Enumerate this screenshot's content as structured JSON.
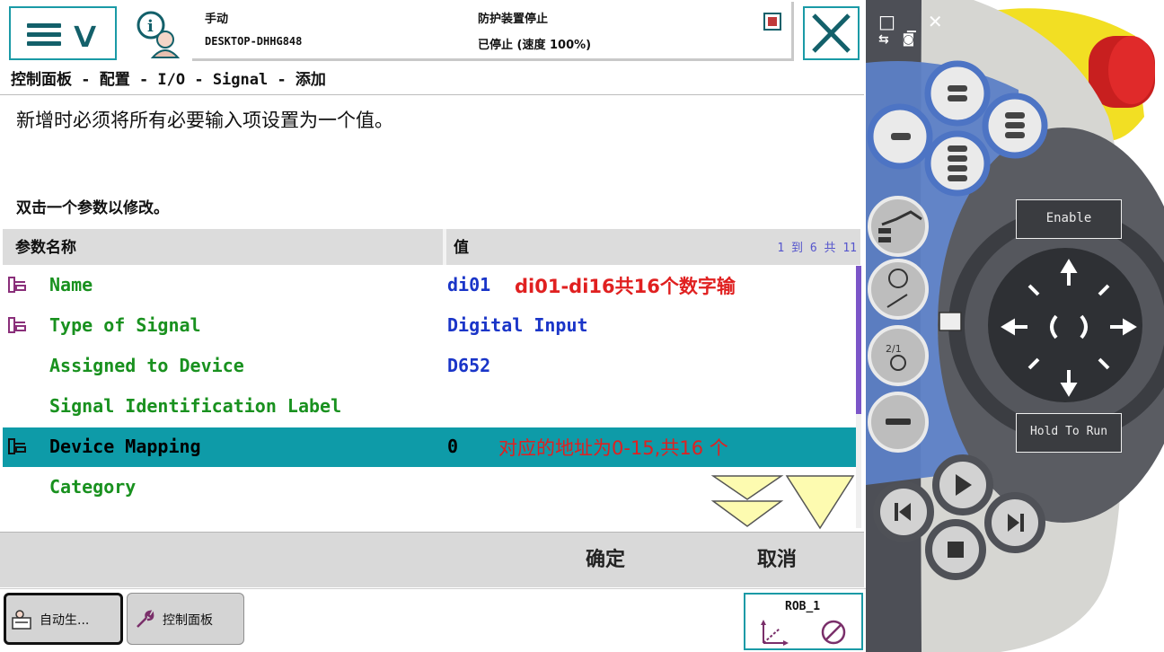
{
  "status": {
    "mode": "手动",
    "controller": "DESKTOP-DHHG848",
    "state": "防护装置停止",
    "speed_text": "已停止 (速度 100%)"
  },
  "breadcrumb": "控制面板 - 配置 - I/O - Signal - 添加",
  "info": {
    "line1": "新增时必须将所有必要输入项设置为一个值。",
    "line2": "双击一个参数以修改。"
  },
  "table": {
    "col_name": "参数名称",
    "col_value": "值",
    "counter": "1 到 6 共 11",
    "rows": [
      {
        "name": "Name",
        "value": "di01",
        "note": "di01-di16共16个数字输"
      },
      {
        "name": "Type of Signal",
        "value": "Digital Input",
        "note": ""
      },
      {
        "name": "Assigned to Device",
        "value": "D652",
        "note": ""
      },
      {
        "name": "Signal Identification Label",
        "value": "",
        "note": ""
      },
      {
        "name": "Device Mapping",
        "value": "0",
        "note": "对应的地址为0-15,共16 个"
      },
      {
        "name": "Category",
        "value": "",
        "note": ""
      }
    ]
  },
  "footer": {
    "ok": "确定",
    "cancel": "取消"
  },
  "taskbar": {
    "task1": "自动生...",
    "task2": "控制面板",
    "rob": "ROB_1"
  },
  "pendant": {
    "enable": "Enable",
    "hold": "Hold To Run"
  },
  "colors": {
    "accent": "#1a9aa6",
    "selected_row": "#0e9ba8",
    "param_name": "#19911f",
    "param_value": "#1a35c8",
    "annotation": "#e02020"
  }
}
